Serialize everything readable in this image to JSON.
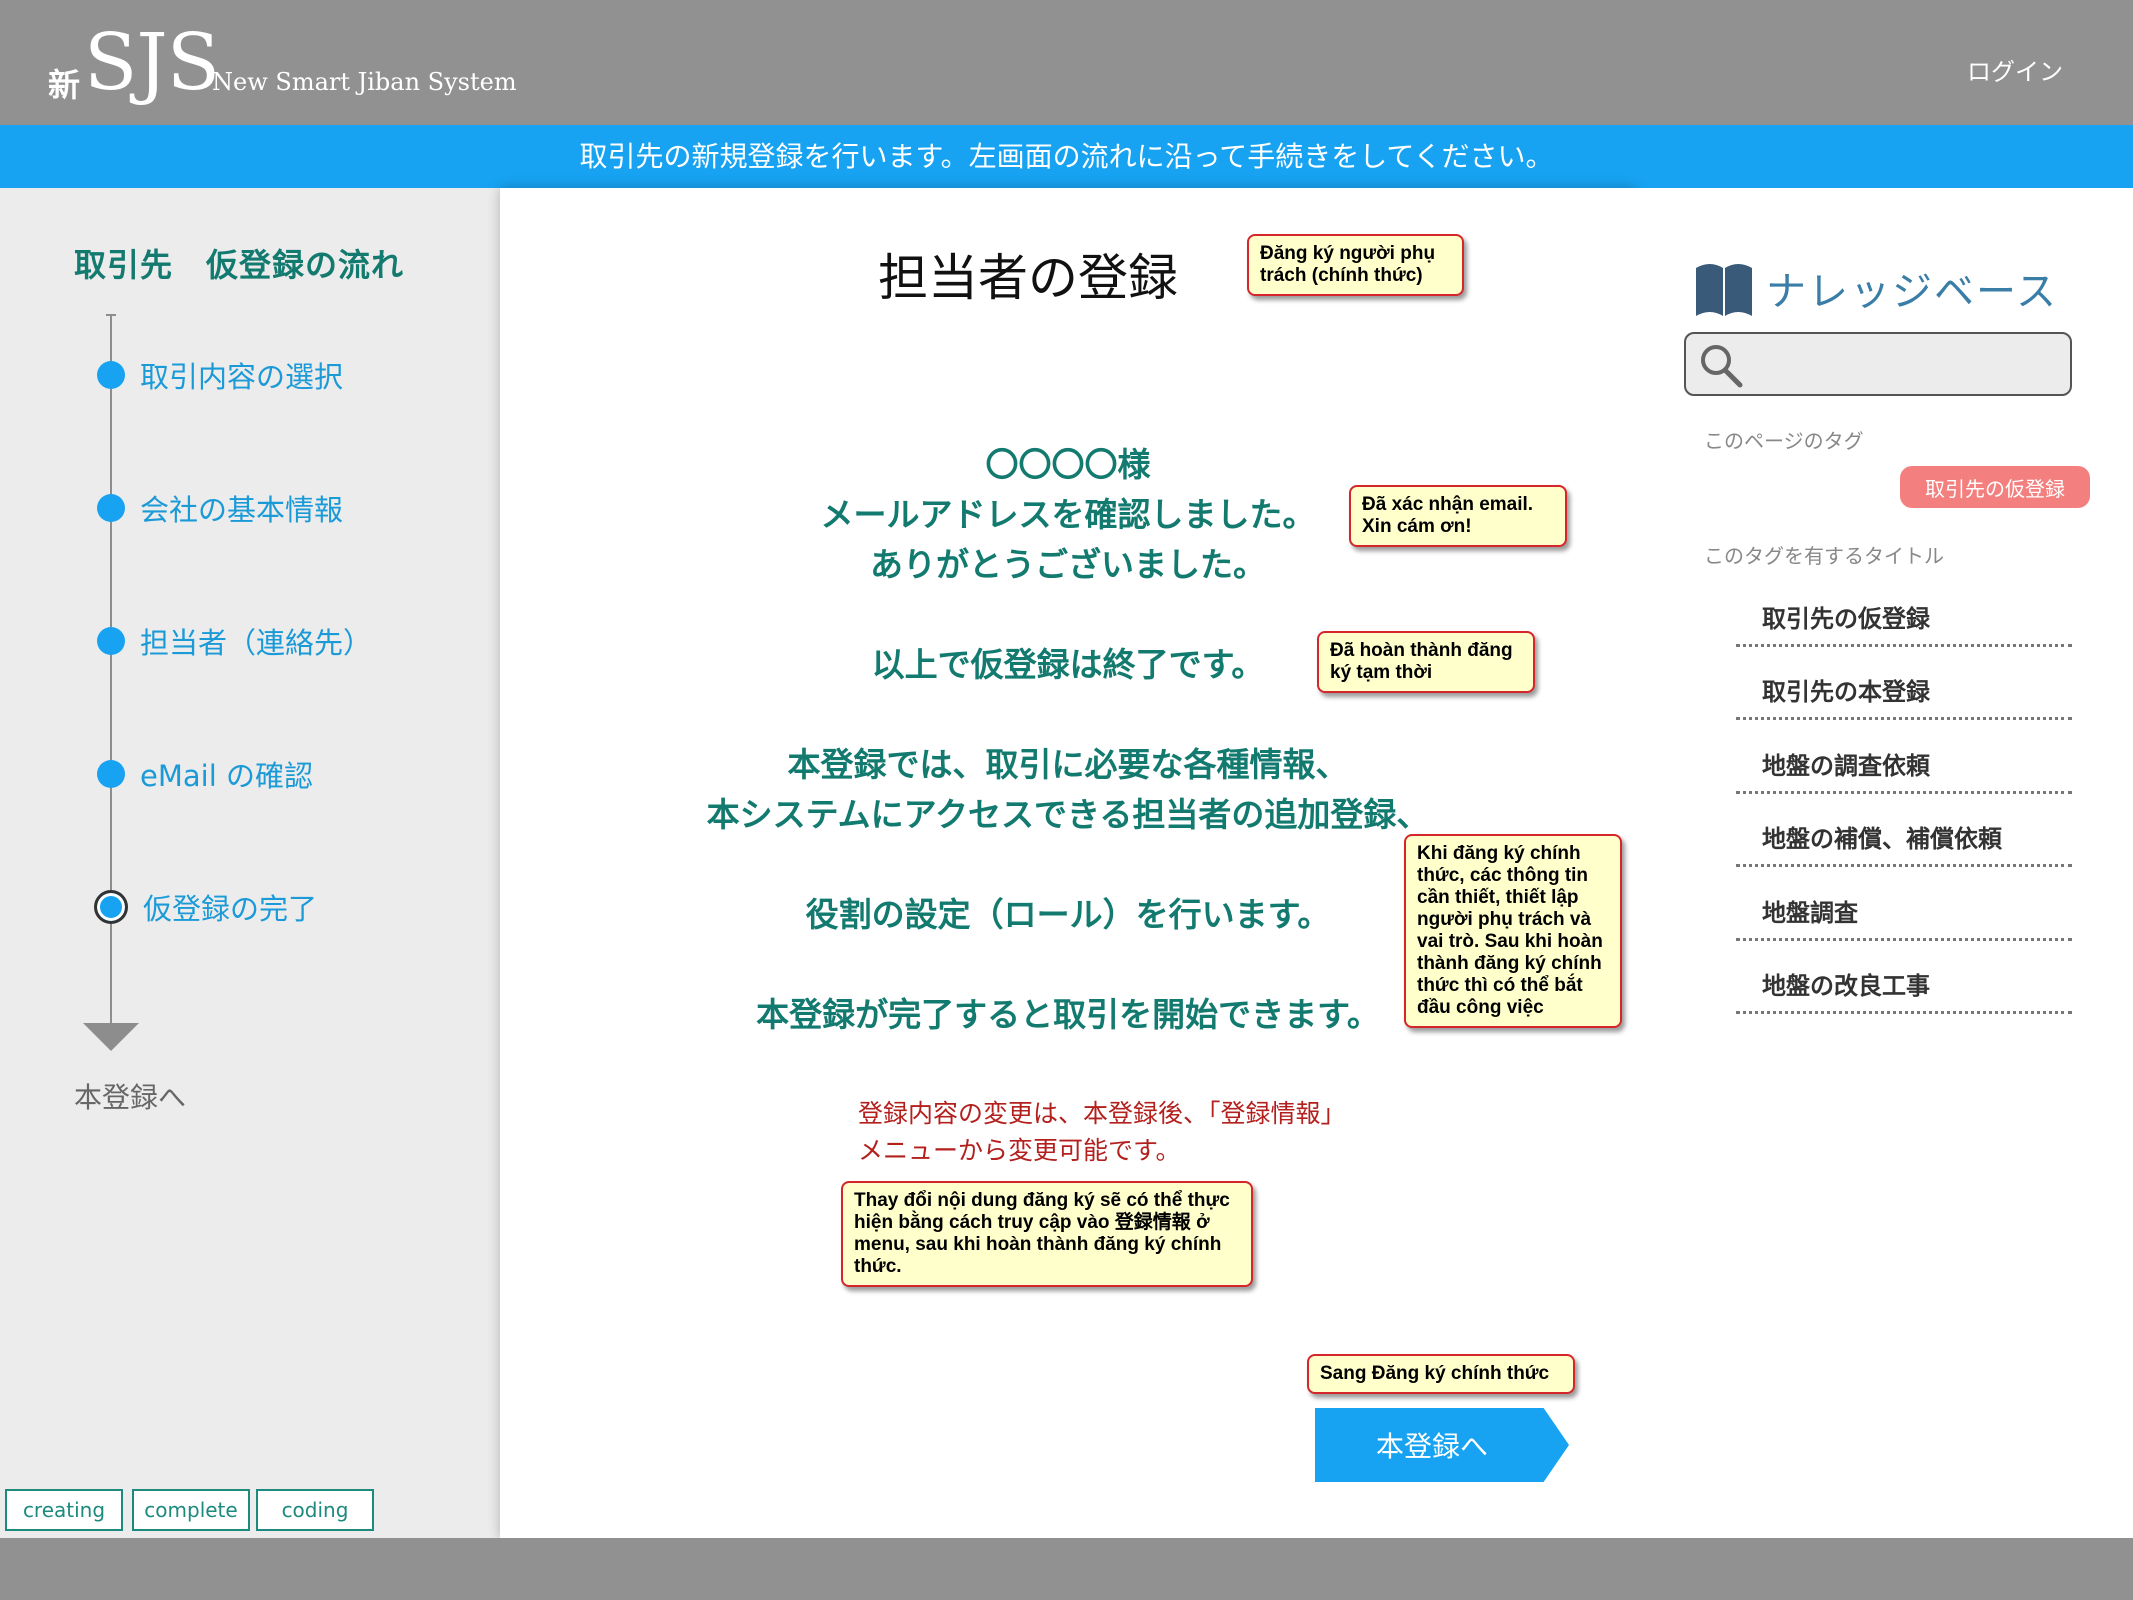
{
  "header": {
    "logo_kanji": "新",
    "logo_main": "SJS",
    "logo_sub": "New Smart Jiban System",
    "login_label": "ログイン"
  },
  "banner": {
    "text": "取引先の新規登録を行います。左画面の流れに沿って手続きをしてください。"
  },
  "sidebar": {
    "title": "取引先　仮登録の流れ",
    "steps": [
      {
        "label": "取引内容の選択"
      },
      {
        "label": "会社の基本情報"
      },
      {
        "label": "担当者（連絡先）"
      },
      {
        "label": "eMail の確認"
      },
      {
        "label": "仮登録の完了",
        "current": true
      }
    ],
    "next_label": "本登録へ"
  },
  "main": {
    "title": "担当者の登録",
    "greeting": [
      "〇〇〇〇様",
      "メールアドレスを確認しました。",
      "ありがとうございました。"
    ],
    "complete": "以上で仮登録は終了です。",
    "info": [
      "本登録では、取引に必要な各種情報、",
      "本システムにアクセスできる担当者の追加登録、"
    ],
    "roles": "役割の設定（ロール）を行います。",
    "start": "本登録が完了すると取引を開始できます。",
    "change_note": [
      "登録内容の変更は、本登録後、「登録情報」",
      "メニューから変更可能です。"
    ],
    "next_button": "本登録へ"
  },
  "callouts": {
    "title": "Đăng ký người phụ trách (chính thức)",
    "email": "Đã xác nhận email. Xin cám ơn!",
    "complete": "Đã hoàn thành đăng ký tạm thời",
    "info": "Khi đăng ký chính thức, các thông tin cần thiết, thiết lập người phụ trách và vai trò. Sau khi hoàn thành đăng ký chính thức thì có thể bắt đầu công việc",
    "change": "Thay đổi nội dung đăng ký sẽ có thể thực hiện bằng cách truy cập vào 登録情報 ở menu, sau khi hoàn thành đăng ký chính thức.",
    "next": "Sang Đăng ký chính thức"
  },
  "knowledge_base": {
    "title": "ナレッジベース",
    "search_placeholder": "",
    "page_tags_label": "このページのタグ",
    "tag": "取引先の仮登録",
    "titles_label": "このタグを有するタイトル",
    "items": [
      {
        "label": "取引先の仮登録"
      },
      {
        "label": "取引先の本登録"
      },
      {
        "label": "地盤の調査依頼"
      },
      {
        "label": "地盤の補償、補償依頼"
      },
      {
        "label": "地盤調査"
      },
      {
        "label": "地盤の改良工事"
      }
    ]
  },
  "status_buttons": [
    {
      "label": "creating"
    },
    {
      "label": "complete"
    },
    {
      "label": "coding"
    }
  ],
  "colors": {
    "header_gray": "#919191",
    "banner_blue": "#17a3f2",
    "teal_text": "#137a6f",
    "step_blue": "#1b9ad8",
    "red_note": "#b3201e",
    "tag_pink": "#f47f7f",
    "callout_bg": "#ffffcc",
    "callout_border": "#d6262b"
  },
  "icons": {
    "search": "magnifier-icon",
    "book": "book-icon",
    "arrow_down": "triangle-down-icon"
  }
}
